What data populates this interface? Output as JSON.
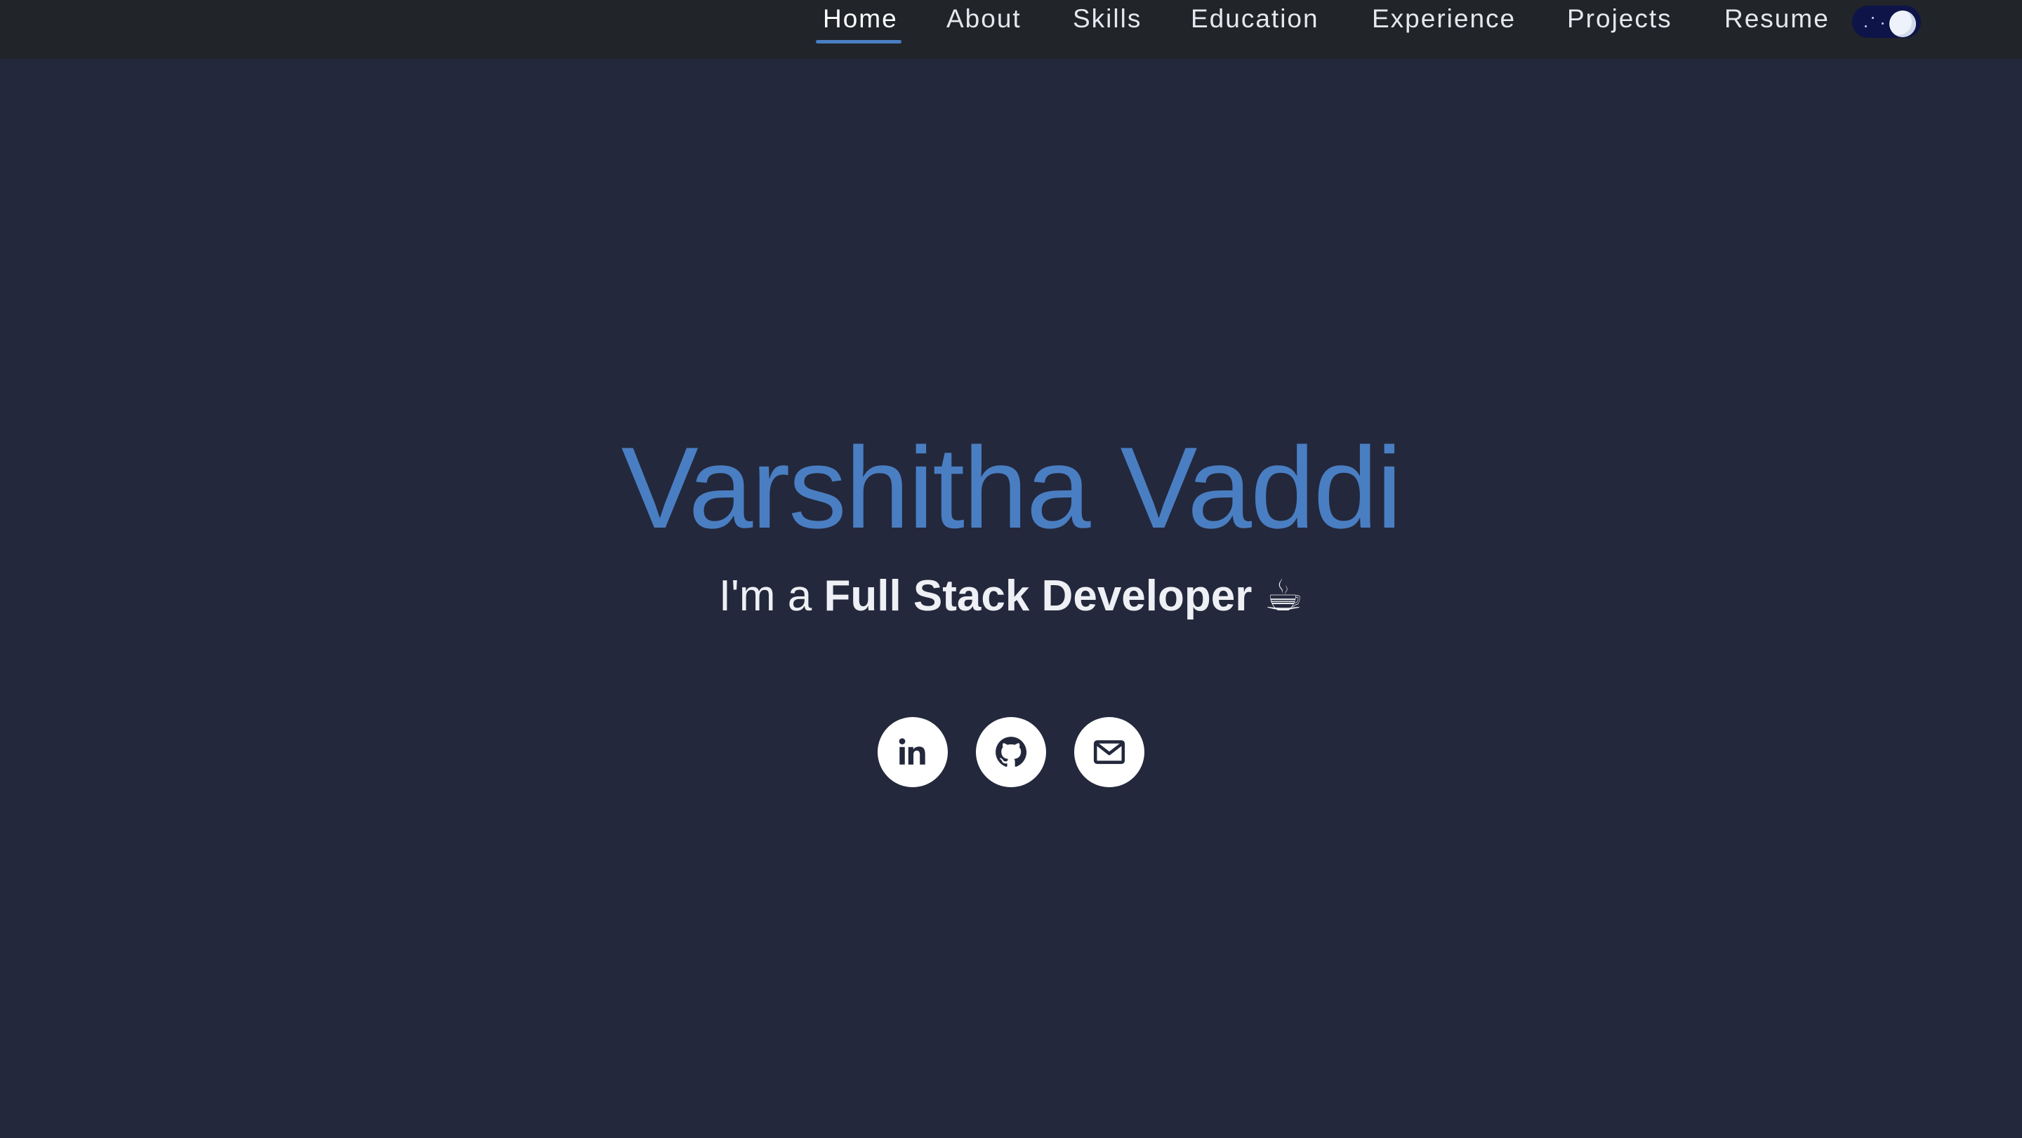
{
  "nav": {
    "items": [
      {
        "label": "Home",
        "active": true
      },
      {
        "label": "About"
      },
      {
        "label": "Skills"
      },
      {
        "label": "Education"
      },
      {
        "label": "Experience"
      },
      {
        "label": "Projects"
      },
      {
        "label": "Resume"
      }
    ],
    "theme_toggle": {
      "state": "dark",
      "icon": "moon-icon"
    }
  },
  "hero": {
    "name": "Varshitha Vaddi",
    "tagline_prefix": "I'm a",
    "tagline_role": "Full Stack Developer",
    "tagline_emoji": "☕"
  },
  "socials": [
    {
      "icon": "linkedin-icon"
    },
    {
      "icon": "github-icon"
    },
    {
      "icon": "mail-icon"
    }
  ],
  "colors": {
    "background": "#23283c",
    "navbar": "#212429",
    "accent": "#4a7ec2",
    "text": "#eef0f5"
  }
}
